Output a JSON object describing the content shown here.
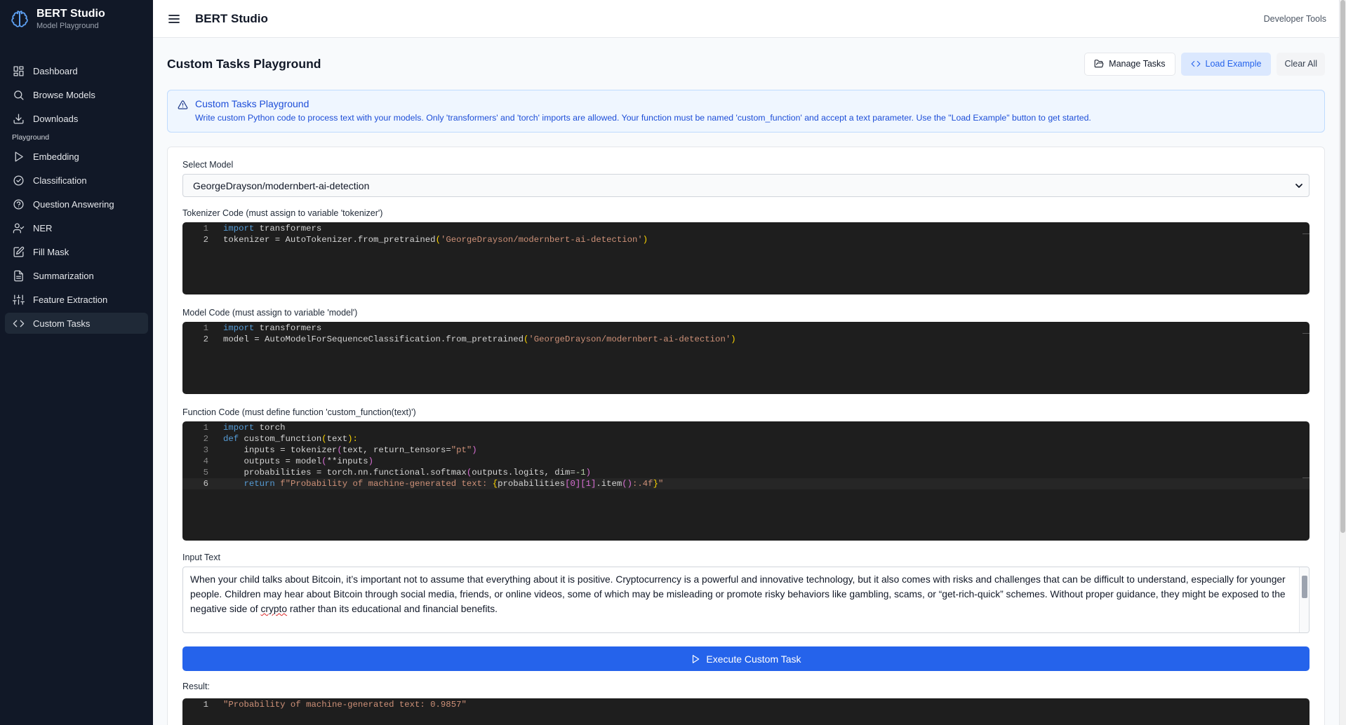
{
  "brand": {
    "title": "BERT Studio",
    "subtitle": "Model Playground"
  },
  "sidebar": {
    "items": [
      {
        "label": "Dashboard",
        "icon": "grid-icon"
      },
      {
        "label": "Browse Models",
        "icon": "search-icon"
      },
      {
        "label": "Downloads",
        "icon": "download-icon"
      }
    ],
    "section_label": "Playground",
    "playground_items": [
      {
        "label": "Embedding",
        "icon": "play-icon"
      },
      {
        "label": "Classification",
        "icon": "check-circle-icon"
      },
      {
        "label": "Question Answering",
        "icon": "help-circle-icon"
      },
      {
        "label": "NER",
        "icon": "user-check-icon"
      },
      {
        "label": "Fill Mask",
        "icon": "edit-icon"
      },
      {
        "label": "Summarization",
        "icon": "file-text-icon"
      },
      {
        "label": "Feature Extraction",
        "icon": "sliders-icon"
      },
      {
        "label": "Custom Tasks",
        "icon": "code-icon",
        "active": true
      }
    ]
  },
  "topbar": {
    "title": "BERT Studio",
    "dev_tools": "Developer Tools"
  },
  "page": {
    "title": "Custom Tasks Playground",
    "actions": {
      "manage": "Manage Tasks",
      "load": "Load Example",
      "clear": "Clear All"
    }
  },
  "alert": {
    "title": "Custom Tasks Playground",
    "body": "Write custom Python code to process text with your models. Only 'transformers' and 'torch' imports are allowed. Your function must be named 'custom_function' and accept a text parameter. Use the \"Load Example\" button to get started."
  },
  "form": {
    "model_label": "Select Model",
    "model_value": "GeorgeDrayson/modernbert-ai-detection",
    "tokenizer_label": "Tokenizer Code (must assign to variable 'tokenizer')",
    "model_code_label": "Model Code (must assign to variable 'model')",
    "function_label": "Function Code (must define function 'custom_function(text)')",
    "input_label": "Input Text",
    "input_value_before": "When your child talks about Bitcoin, it’s important not to assume that everything about it is positive. Cryptocurrency is a powerful and innovative technology, but it also comes with risks and challenges that can be difficult to understand, especially for younger people. Children may hear about Bitcoin through social media, friends, or online videos, some of which may be misleading or promote risky behaviors like gambling, scams, or “get-rich-quick” schemes. Without proper guidance, they might be exposed to the negative side of ",
    "input_value_misspelled": "crypto",
    "input_value_after": " rather than its educational and financial benefits.",
    "execute_label": "Execute Custom Task",
    "result_label": "Result:"
  },
  "code": {
    "tokenizer": {
      "ln": [
        "1",
        "2"
      ],
      "l1_kw": "import",
      "l1_rest": " transformers",
      "l2_pre": "tokenizer = AutoTokenizer.from_pretrained",
      "l2_open": "(",
      "l2_str": "'GeorgeDrayson/modernbert-ai-detection'",
      "l2_close": ")"
    },
    "model": {
      "ln": [
        "1",
        "2"
      ],
      "l1_kw": "import",
      "l1_rest": " transformers",
      "l2_pre": "model = AutoModelForSequenceClassification.from_pretrained",
      "l2_open": "(",
      "l2_str": "'GeorgeDrayson/modernbert-ai-detection'",
      "l2_close": ")"
    },
    "function": {
      "ln": [
        "1",
        "2",
        "3",
        "4",
        "5",
        "6"
      ],
      "l1_kw": "import",
      "l1_rest": " torch",
      "l2_kw": "def",
      "l2_name": " custom_function",
      "l2_open": "(",
      "l2_arg": "text",
      "l2_close": "):",
      "l3_pre": "    inputs = tokenizer",
      "l3_open": "(",
      "l3_mid": "text, return_tensors=",
      "l3_str": "\"pt\"",
      "l3_close": ")",
      "l4_pre": "    outputs = model",
      "l4_open": "(",
      "l4_mid": "**inputs",
      "l4_close": ")",
      "l5_pre": "    probabilities = torch.nn.functional.softmax",
      "l5_open": "(",
      "l5_mid": "outputs.logits, dim=",
      "l5_num": "-1",
      "l5_close": ")",
      "l6_ind": "    ",
      "l6_kw": "return",
      "l6_str1": " f\"Probability of machine-generated text: ",
      "l6_b1": "{",
      "l6_var": "probabilities",
      "l6_idx1": "[0]",
      "l6_idx2": "[1]",
      "l6_item": ".item",
      "l6_call": "()",
      "l6_fmt": ":.4f",
      "l6_b2": "}",
      "l6_end": "\""
    },
    "result": {
      "ln": "1",
      "value": "\"Probability of machine-generated text: 0.9857\""
    }
  }
}
